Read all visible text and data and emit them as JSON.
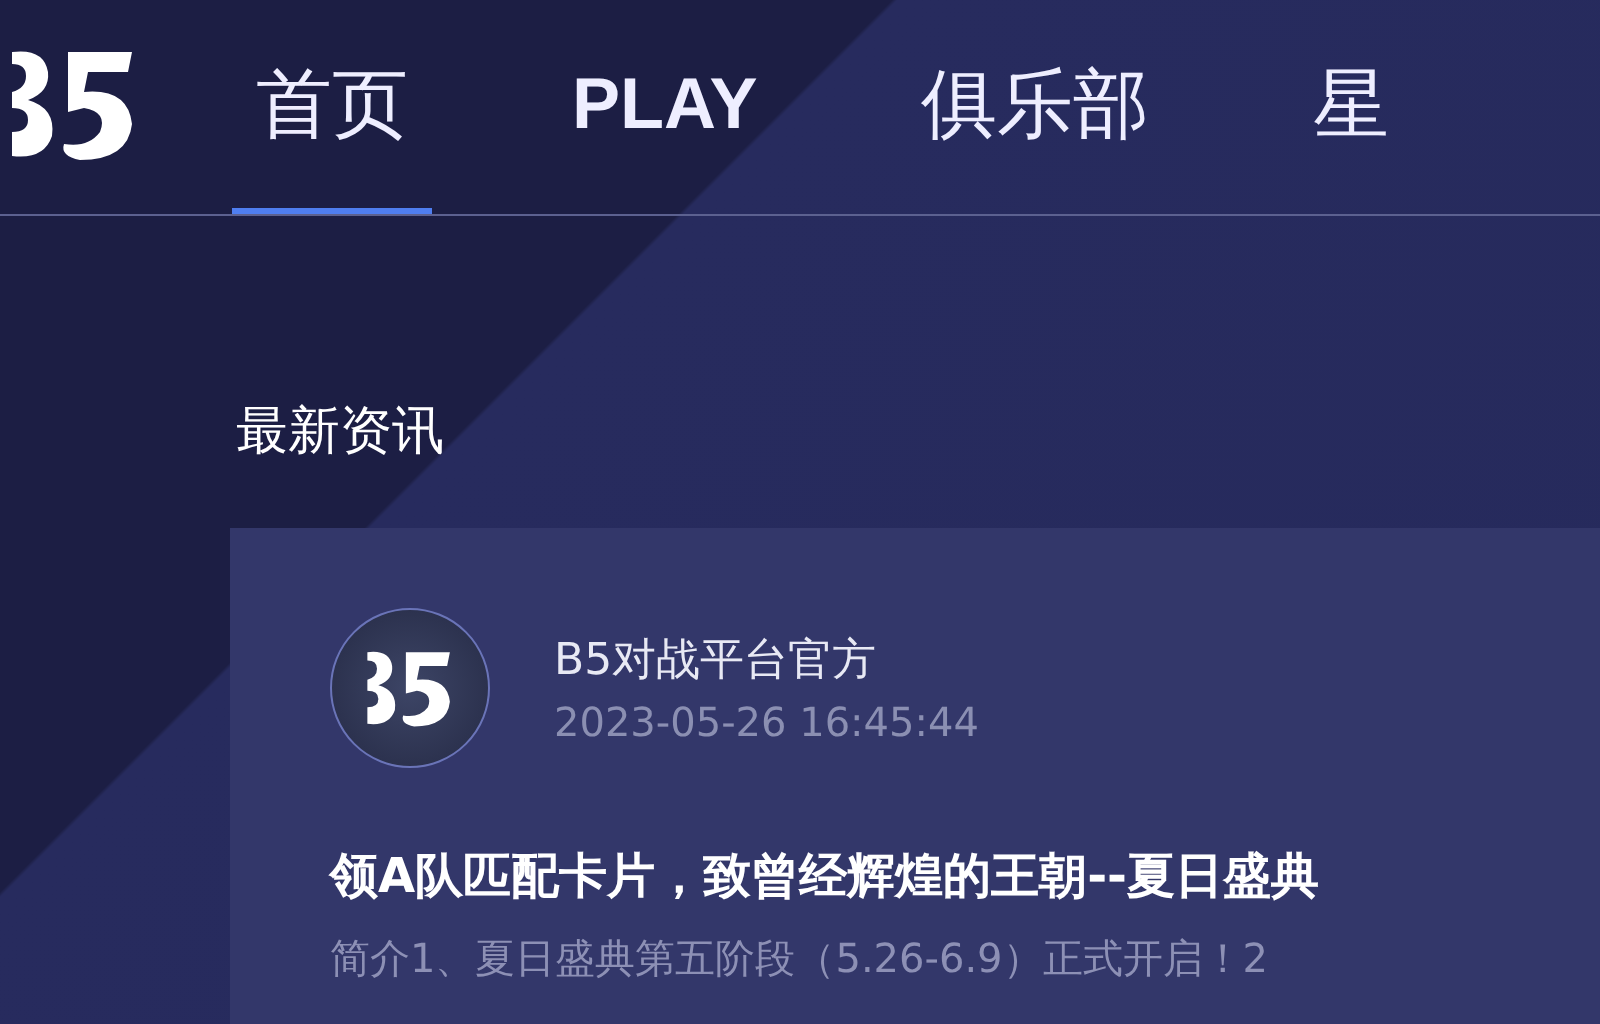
{
  "nav": {
    "items": [
      {
        "label": "首页",
        "selected": true
      },
      {
        "label": "PLAY",
        "selected": false
      },
      {
        "label": "俱乐部",
        "selected": false
      },
      {
        "label": "星",
        "selected": false
      }
    ]
  },
  "section_title": "最新资讯",
  "post": {
    "author": "B5对战平台官方",
    "time": "2023-05-26 16:45:44",
    "title": "领A队匹配卡片，致曾经辉煌的王朝--夏日盛典",
    "summary": "简介1、夏日盛典第五阶段（5.26-6.9）正式开启！2"
  }
}
